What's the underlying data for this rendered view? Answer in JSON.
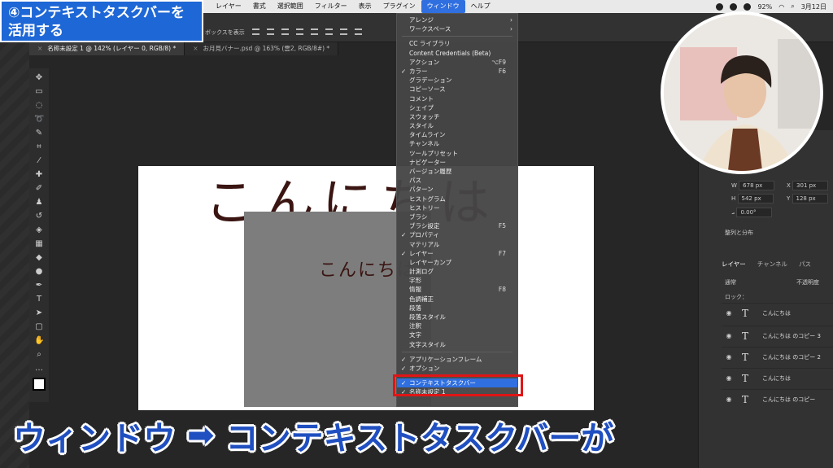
{
  "banner": {
    "line1": "④コンテキストタスクバーを",
    "line2": "活用する"
  },
  "menubar": {
    "items": [
      "レイヤー",
      "書式",
      "選択範囲",
      "フィルター",
      "表示",
      "プラグイン",
      "ウィンドウ",
      "ヘルプ"
    ],
    "active": "ウィンドウ",
    "battery": "92%",
    "date": "3月12日"
  },
  "optionsbar": {
    "text": "ボックスを表示"
  },
  "tabs": [
    {
      "label": "名称未設定 1 @ 142% (レイヤー 0, RGB/8) *",
      "active": true
    },
    {
      "label": "お月見バナー.psd @ 163% (雲2, RGB/8#) *",
      "active": false
    }
  ],
  "canvas": {
    "big_text": "こんにちは",
    "small_text": "こんにちは"
  },
  "window_menu": {
    "groups": [
      [
        {
          "label": "アレンジ",
          "submenu": true
        },
        {
          "label": "ワークスペース",
          "submenu": true
        }
      ],
      [
        {
          "label": "CC ライブラリ"
        },
        {
          "label": "Content Credentials (Beta)"
        },
        {
          "label": "アクション",
          "shortcut": "⌥F9"
        },
        {
          "label": "カラー",
          "checked": true,
          "shortcut": "F6"
        },
        {
          "label": "グラデーション"
        },
        {
          "label": "コピーソース"
        },
        {
          "label": "コメント"
        },
        {
          "label": "シェイプ"
        },
        {
          "label": "スウォッチ"
        },
        {
          "label": "スタイル"
        },
        {
          "label": "タイムライン"
        },
        {
          "label": "チャンネル"
        },
        {
          "label": "ツールプリセット"
        },
        {
          "label": "ナビゲーター"
        },
        {
          "label": "バージョン履歴"
        },
        {
          "label": "パス"
        },
        {
          "label": "パターン"
        },
        {
          "label": "ヒストグラム"
        },
        {
          "label": "ヒストリー"
        },
        {
          "label": "ブラシ"
        },
        {
          "label": "ブラシ設定",
          "shortcut": "F5"
        },
        {
          "label": "プロパティ",
          "checked": true
        },
        {
          "label": "マテリアル"
        },
        {
          "label": "レイヤー",
          "checked": true,
          "shortcut": "F7"
        },
        {
          "label": "レイヤーカンプ"
        },
        {
          "label": "計測ログ"
        },
        {
          "label": "字形"
        },
        {
          "label": "情報",
          "shortcut": "F8"
        },
        {
          "label": "色調補正"
        },
        {
          "label": "段落"
        },
        {
          "label": "段落スタイル"
        },
        {
          "label": "注釈"
        },
        {
          "label": "文字"
        },
        {
          "label": "文字スタイル"
        }
      ],
      [
        {
          "label": "アプリケーションフレーム",
          "checked": true
        },
        {
          "label": "オプション",
          "checked": true
        }
      ],
      [
        {
          "label": "コンテキストタスクバー",
          "checked": true,
          "highlighted": true
        },
        {
          "label": "名称未設定 1",
          "checked": true
        }
      ]
    ]
  },
  "properties": {
    "w": "678 px",
    "x": "301 px",
    "h": "542 px",
    "y": "128 px",
    "angle": "0.00°",
    "align_section": "整列と分布"
  },
  "layers_panel": {
    "tabs": [
      "レイヤー",
      "チャンネル",
      "パス"
    ],
    "blend_mode": "通常",
    "opacity_label": "不透明度",
    "lock_label": "ロック：",
    "layers": [
      "こんにちは",
      "こんにちは のコピー 3",
      "こんにちは のコピー 2",
      "こんにちは",
      "こんにちは のコピー"
    ]
  },
  "subtitle": {
    "left": "ウィンドウ",
    "arrow": "➡",
    "right": "コンテキストタスクバーが"
  }
}
